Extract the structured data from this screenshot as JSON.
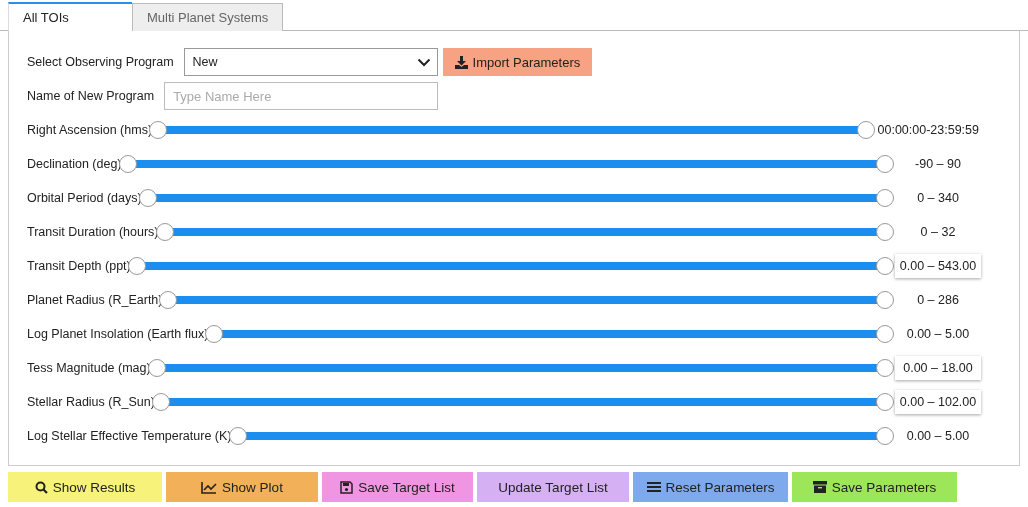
{
  "tabs": [
    {
      "label": "All TOIs",
      "selected": true
    },
    {
      "label": "Multi Planet Systems",
      "selected": false
    }
  ],
  "program_select": {
    "label": "Select Observing Program",
    "value": "New"
  },
  "import_button": {
    "label": "Import Parameters"
  },
  "new_program": {
    "label": "Name of New Program",
    "placeholder": "Type Name Here"
  },
  "sliders": [
    {
      "label": "Right Ascension (hms)",
      "reading": "00:00:00-23:59:59",
      "boxed": false
    },
    {
      "label": "Declination (deg)",
      "reading": "-90 – 90",
      "boxed": false
    },
    {
      "label": "Orbital Period (days)",
      "reading": "0 – 340",
      "boxed": false
    },
    {
      "label": "Transit Duration (hours)",
      "reading": "0 – 32",
      "boxed": false
    },
    {
      "label": "Transit Depth (ppt)",
      "reading": "0.00 – 543.00",
      "boxed": true
    },
    {
      "label": "Planet Radius (R_Earth)",
      "reading": "0 – 286",
      "boxed": false
    },
    {
      "label": "Log Planet Insolation (Earth flux)",
      "reading": "0.00 – 5.00",
      "boxed": false
    },
    {
      "label": "Tess Magnitude (mag)",
      "reading": "0.00 – 18.00",
      "boxed": true
    },
    {
      "label": "Stellar Radius (R_Sun)",
      "reading": "0.00 – 102.00",
      "boxed": true
    },
    {
      "label": "Log Stellar Effective Temperature (K)",
      "reading": "0.00 – 5.00",
      "boxed": false
    }
  ],
  "actions": [
    {
      "label": "Show Results",
      "kind": "search",
      "color": "#f7f37a"
    },
    {
      "label": "Show Plot",
      "kind": "chart",
      "color": "#f2b158"
    },
    {
      "label": "Save Target List",
      "kind": "save",
      "color": "#f095e2"
    },
    {
      "label": "Update Target List",
      "kind": "none",
      "color": "#d5b0f3"
    },
    {
      "label": "Reset Parameters",
      "kind": "list",
      "color": "#7eaaed"
    },
    {
      "label": "Save Parameters",
      "kind": "archive",
      "color": "#9de65a"
    }
  ]
}
